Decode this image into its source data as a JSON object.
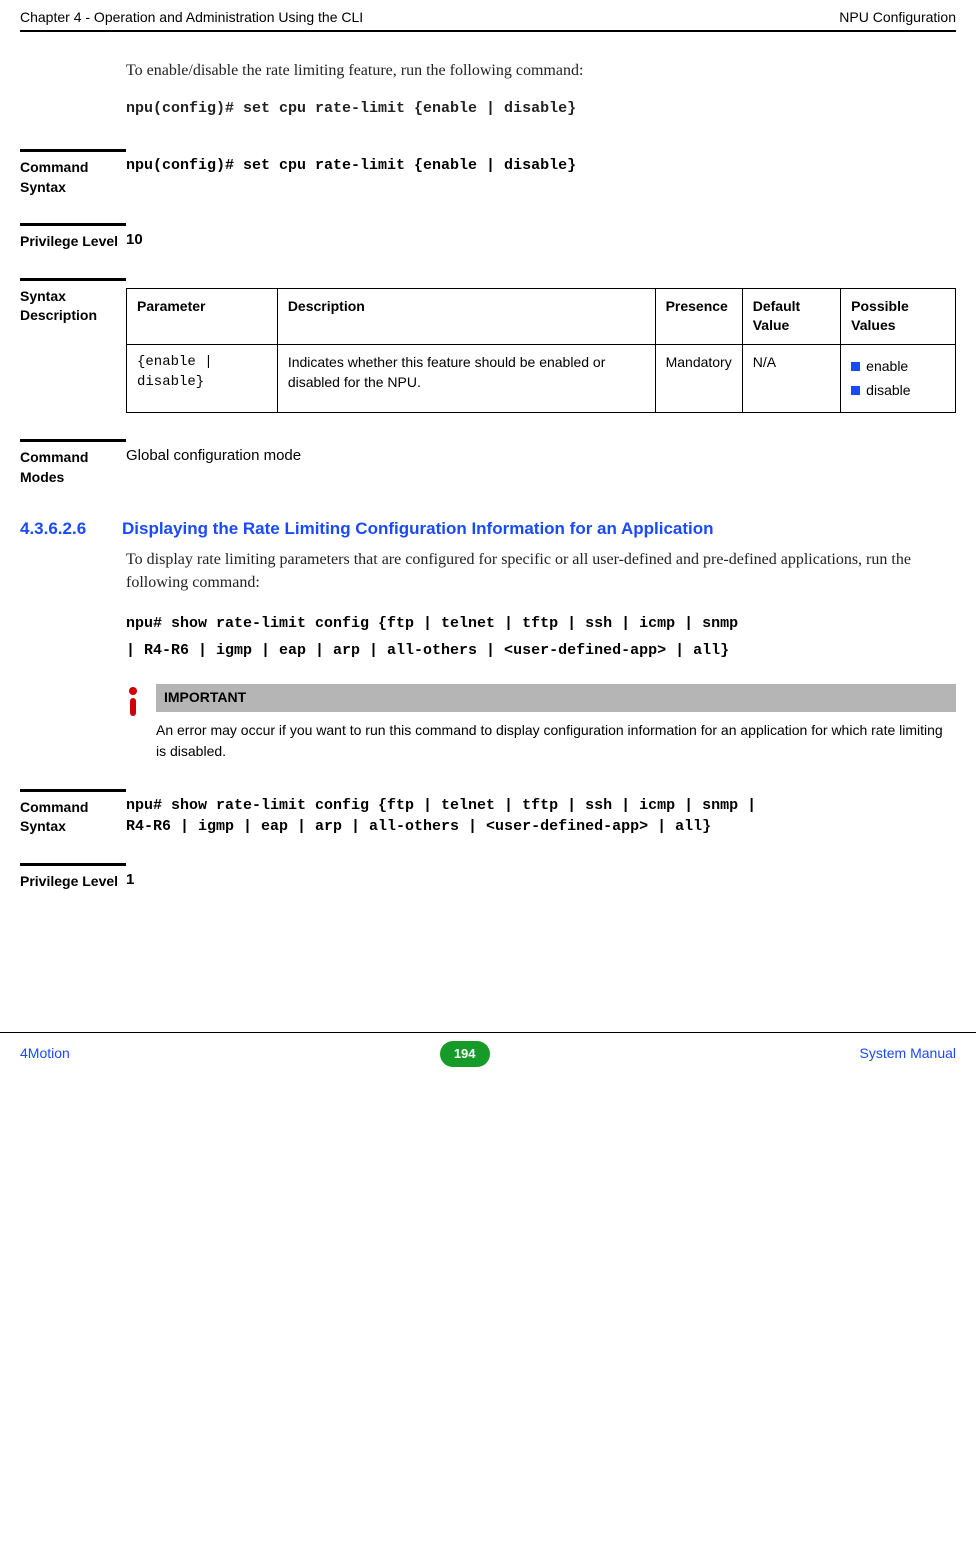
{
  "header": {
    "left": "Chapter 4 - Operation and Administration Using the CLI",
    "right": "NPU Configuration"
  },
  "intro": "To enable/disable the rate limiting feature, run the following command:",
  "cmd_line": "npu(config)# set cpu rate-limit {enable | disable}",
  "labels": {
    "cmd_syntax": "Command Syntax",
    "priv_level": "Privilege Level",
    "priv_level_val": "10",
    "syntax_desc": "Syntax Description",
    "cmd_modes": "Command Modes",
    "cmd_modes_val": "Global configuration mode"
  },
  "cmd_syntax_val": "npu(config)# set cpu rate-limit {enable | disable}",
  "table": {
    "headers": {
      "param": "Parameter",
      "desc": "Description",
      "pres": "Presence",
      "def": "Default Value",
      "poss": "Possible Values"
    },
    "row": {
      "param": "{enable | disable}",
      "desc": "Indicates whether this feature should be enabled or disabled for the NPU.",
      "pres": "Mandatory",
      "def": "N/A",
      "poss1": "enable",
      "poss2": "disable"
    }
  },
  "section": {
    "num": "4.3.6.2.6",
    "title": "Displaying the Rate Limiting Configuration Information for an Application",
    "body": "To display rate limiting parameters that are configured for specific or all user-defined and pre-defined applications, run the following command:",
    "cmd1": "npu# show rate-limit config {ftp | telnet | tftp | ssh | icmp | snmp",
    "cmd2": "| R4-R6 | igmp | eap | arp | all-others | <user-defined-app> | all}"
  },
  "note": {
    "title": "IMPORTANT",
    "text": "An error may occur if you want to run this command to display configuration information for an application for which rate limiting is disabled."
  },
  "section2": {
    "cmd_syntax_label": "Command Syntax",
    "cmd_syntax_val1": "npu# show rate-limit config {ftp | telnet | tftp | ssh | icmp | snmp |",
    "cmd_syntax_val2": "R4-R6 | igmp | eap | arp | all-others | <user-defined-app> | all}",
    "priv_level_label": "Privilege Level",
    "priv_level_val": "1"
  },
  "footer": {
    "left": "4Motion",
    "page": "194",
    "right": "System Manual"
  }
}
